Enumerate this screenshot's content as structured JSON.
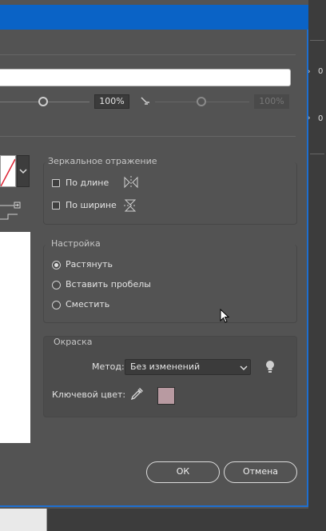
{
  "stroke": {
    "scale_percent": "100%",
    "scale_percent_disabled": "100%"
  },
  "mirror": {
    "title": "Зеркальное отражение",
    "by_length": "По длине",
    "by_width": "По ширине"
  },
  "settings": {
    "title": "Настройка",
    "options": [
      "Растянуть",
      "Вставить пробелы",
      "Сместить"
    ],
    "selected_index": 0
  },
  "coloring": {
    "title": "Окраска",
    "method_label": "Метод:",
    "method_value": "Без изменений",
    "key_color_label": "Ключевой цвет:",
    "key_color": "#b89aa1"
  },
  "buttons": {
    "ok": "ОК",
    "cancel": "Отмена"
  },
  "right_panel": {
    "value_1": "0",
    "value_2": "0"
  }
}
